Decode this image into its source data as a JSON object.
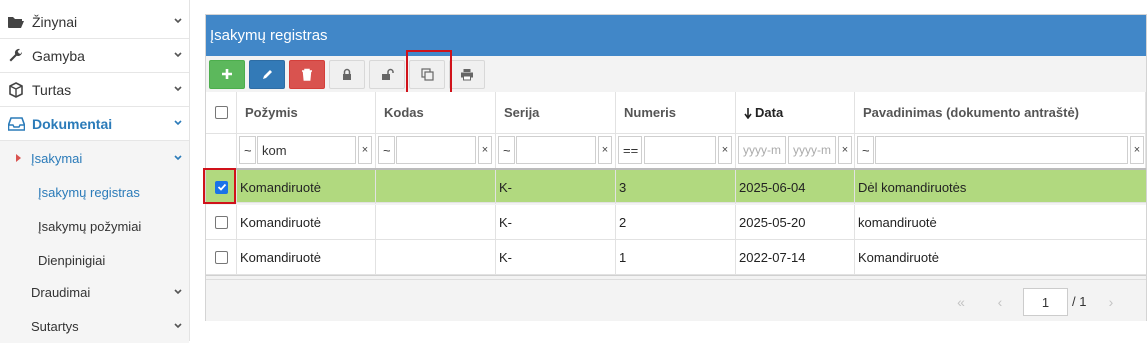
{
  "sidebar": {
    "items": [
      {
        "label": "Žinynai",
        "icon": "folder-open-icon"
      },
      {
        "label": "Gamyba",
        "icon": "wrench-icon"
      },
      {
        "label": "Turtas",
        "icon": "cube-icon"
      },
      {
        "label": "Dokumentai",
        "icon": "inbox-icon"
      }
    ],
    "subitems": {
      "isakymai": "Įsakymai",
      "registras": "Įsakymų registras",
      "pozymiai": "Įsakymų požymiai",
      "dienpinigiai": "Dienpinigiai",
      "draudimai": "Draudimai",
      "sutartys": "Sutartys"
    }
  },
  "panel": {
    "title": "Įsakymų registras"
  },
  "grid": {
    "columns": [
      "Požymis",
      "Kodas",
      "Serija",
      "Numeris",
      "Data",
      "Pavadinimas (dokumento antraštė)"
    ],
    "filters": {
      "pozymis_op": "~",
      "pozymis_val": "kom",
      "kodas_op": "~",
      "serija_op": "~",
      "numeris_op": "==",
      "date_from_ph": "yyyy-m",
      "date_to_ph": "yyyy-m",
      "pav_op": "~",
      "clear": "×"
    },
    "rows": [
      {
        "pozymis": "Komandiruotė",
        "kodas": "",
        "serija": "K-",
        "numeris": "3",
        "data": "2025-06-04",
        "pavadinimas": "Dėl komandiruotės",
        "selected": true
      },
      {
        "pozymis": "Komandiruotė",
        "kodas": "",
        "serija": "K-",
        "numeris": "2",
        "data": "2025-05-20",
        "pavadinimas": "komandiruotė",
        "selected": false
      },
      {
        "pozymis": "Komandiruotė",
        "kodas": "",
        "serija": "K-",
        "numeris": "1",
        "data": "2022-07-14",
        "pavadinimas": "Komandiruotė",
        "selected": false
      }
    ]
  },
  "pager": {
    "page": "1",
    "total": "/ 1",
    "first": "«",
    "prev": "‹",
    "next": "›",
    "last": "»"
  },
  "colors": {
    "header_blue": "#4187c8",
    "selected_row": "#b1d97f",
    "highlight": "#d0121a"
  }
}
